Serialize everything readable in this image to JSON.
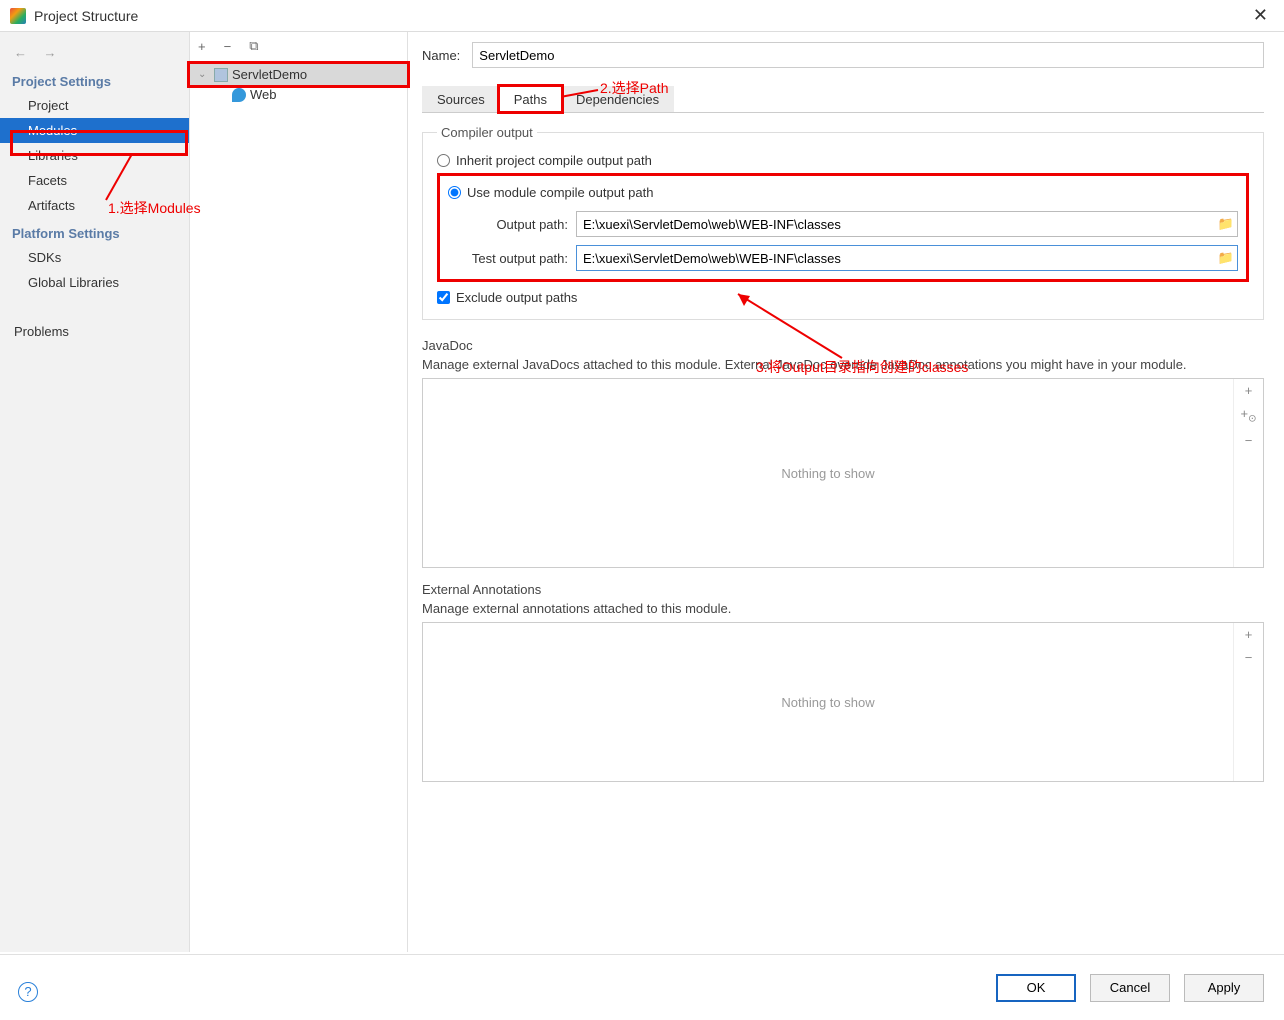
{
  "window": {
    "title": "Project Structure"
  },
  "sidebar": {
    "sections": [
      {
        "label": "Project Settings",
        "items": [
          "Project",
          "Modules",
          "Libraries",
          "Facets",
          "Artifacts"
        ]
      },
      {
        "label": "Platform Settings",
        "items": [
          "SDKs",
          "Global Libraries"
        ]
      }
    ],
    "problems": "Problems"
  },
  "tree": {
    "root": "ServletDemo",
    "child": "Web"
  },
  "form": {
    "name_label": "Name:",
    "name_value": "ServletDemo",
    "tabs": [
      "Sources",
      "Paths",
      "Dependencies"
    ],
    "compiler_group": "Compiler output",
    "radio_inherit": "Inherit project compile output path",
    "radio_module": "Use module compile output path",
    "output_label": "Output path:",
    "output_value": "E:\\xuexi\\ServletDemo\\web\\WEB-INF\\classes",
    "test_output_label": "Test output path:",
    "test_output_value": "E:\\xuexi\\ServletDemo\\web\\WEB-INF\\classes",
    "exclude": "Exclude output paths",
    "javadoc_title": "JavaDoc",
    "javadoc_desc": "Manage external JavaDocs attached to this module. External JavaDoc override JavaDoc annotations you might have in your module.",
    "ext_ann_title": "External Annotations",
    "ext_ann_desc": "Manage external annotations attached to this module.",
    "empty": "Nothing to show"
  },
  "buttons": {
    "ok": "OK",
    "cancel": "Cancel",
    "apply": "Apply"
  },
  "annotations": {
    "a1": "1.选择Modules",
    "a2": "2.选择Path",
    "a3": "3.将Output目录指向创建的classes"
  }
}
